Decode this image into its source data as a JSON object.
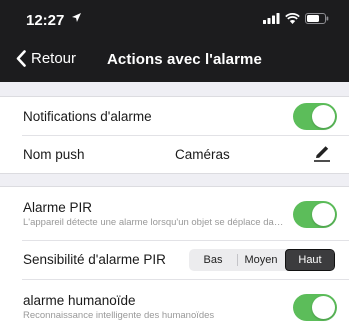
{
  "status_bar": {
    "time": "12:27"
  },
  "nav": {
    "back_label": "Retour",
    "title": "Actions avec l'alarme"
  },
  "settings": {
    "notifications": {
      "label": "Notifications d'alarme",
      "enabled": true
    },
    "push_name": {
      "label": "Nom push",
      "value": "Caméras"
    },
    "pir_alarm": {
      "label": "Alarme PIR",
      "description": "L'appareil détecte une alarme lorsqu'un objet se déplace dans la zone de détection",
      "enabled": true
    },
    "pir_sensitivity": {
      "label": "Sensibilité d'alarme PIR",
      "options": [
        "Bas",
        "Moyen",
        "Haut"
      ],
      "selected": "Haut"
    },
    "humanoid_alarm": {
      "label": "alarme humanoïde",
      "description": "Reconnaissance intelligente des humanoïdes",
      "enabled": true
    }
  },
  "colors": {
    "toggle_on": "#5cbd5a",
    "bar_bg": "#1c1c1e",
    "page_bg": "#efeff4"
  }
}
